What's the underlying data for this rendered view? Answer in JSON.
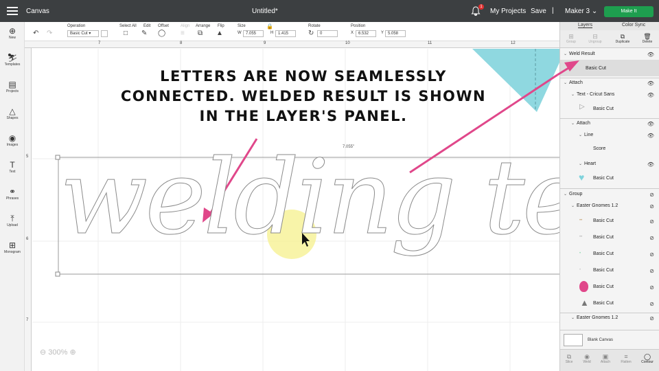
{
  "topbar": {
    "app_title": "Canvas",
    "doc_title": "Untitled*",
    "notification_count": "1",
    "my_projects": "My Projects",
    "save": "Save",
    "separator": "|",
    "machine": "Maker 3",
    "make_it": "Make It"
  },
  "toolbar": {
    "operation_label": "Operation",
    "operation_value": "Basic Cut",
    "select_all": "Select All",
    "edit": "Edit",
    "offset": "Offset",
    "align": "Align",
    "arrange": "Arrange",
    "flip": "Flip",
    "size_label": "Size",
    "w_label": "W",
    "w_value": "7.055",
    "h_label": "H",
    "h_value": "1.415",
    "rotate_label": "Rotate",
    "rotate_value": "0",
    "position_label": "Position",
    "x_label": "X",
    "x_value": "6.532",
    "y_label": "Y",
    "y_value": "5.058"
  },
  "ruler": {
    "top": [
      "7",
      "8",
      "9",
      "10",
      "11",
      "12"
    ],
    "left": [
      "5",
      "6",
      "7"
    ]
  },
  "sidebar": {
    "items": [
      {
        "label": "New",
        "icon": "plus-circle-icon"
      },
      {
        "label": "Templates",
        "icon": "shirt-icon"
      },
      {
        "label": "Projects",
        "icon": "clipboard-icon"
      },
      {
        "label": "Shapes",
        "icon": "shapes-icon"
      },
      {
        "label": "Images",
        "icon": "bulb-icon"
      },
      {
        "label": "Text",
        "icon": "text-icon"
      },
      {
        "label": "Phrases",
        "icon": "speech-icon"
      },
      {
        "label": "Upload",
        "icon": "upload-icon"
      },
      {
        "label": "Monogram",
        "icon": "monogram-icon"
      }
    ]
  },
  "canvas": {
    "annotation_lines": [
      "LETTERS ARE NOW SEAMLESSLY",
      "CONNECTED. WELDED RESULT IS SHOWN",
      "IN THE LAYER'S PANEL."
    ],
    "dimension_label": "7.055\"",
    "zoom": "300%",
    "welded_text": "welding tex"
  },
  "panel": {
    "tab_layers": "Layers",
    "tab_color_sync": "Color Sync",
    "actions": [
      "Group",
      "Ungroup",
      "Duplicate",
      "Delete"
    ],
    "layers": {
      "weld_result": "Weld Result",
      "weld_result_child": "Basic Cut",
      "attach": "Attach",
      "text_layer": "Text - Cricut Sans",
      "text_child": "Basic Cut",
      "attach_inner": "Attach",
      "line": "Line",
      "score": "Score",
      "heart": "Heart",
      "heart_child": "Basic Cut",
      "group": "Group",
      "gnomes1": "Easter Gnomes 1.2",
      "gnome_rows": [
        "Basic Cut",
        "Basic Cut",
        "Basic Cut",
        "Basic Cut",
        "Basic Cut",
        "Basic Cut"
      ],
      "gnomes2": "Easter Gnomes 1.2"
    },
    "blank_canvas": "Blank Canvas",
    "bottom_tools": [
      "Slice",
      "Weld",
      "Attach",
      "Flatten",
      "Contour"
    ]
  },
  "colors": {
    "accent_green": "#1e9e4f",
    "arrow_pink": "#e0478a",
    "heart_teal": "#7fd3dc",
    "highlight_yellow": "#f5f08c"
  }
}
